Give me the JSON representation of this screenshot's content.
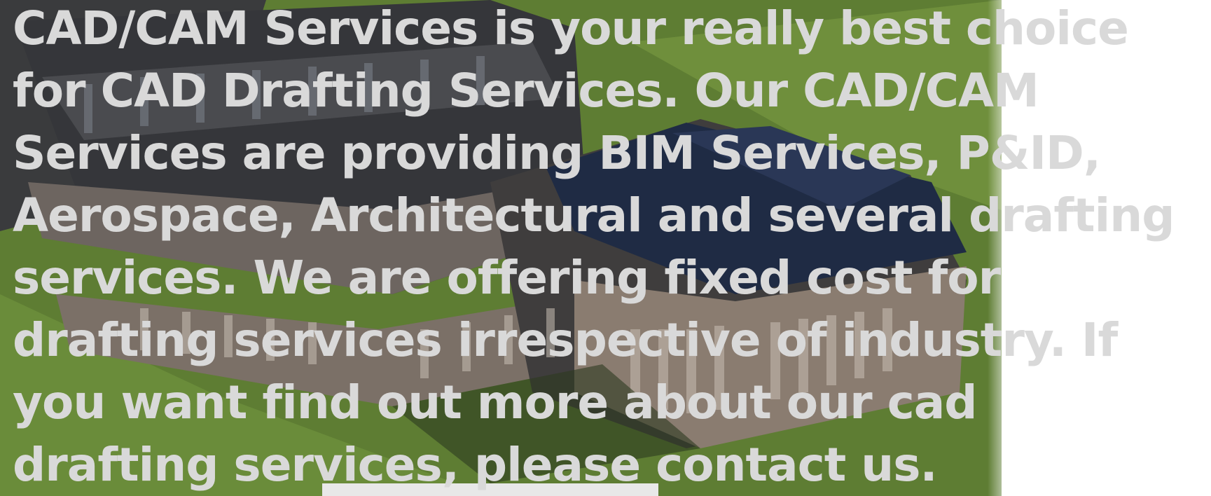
{
  "caption": {
    "lines": [
      "CAD/CAM Services is your really best choice",
      "for CAD Drafting Services. Our CAD/CAM",
      "Services are providing BIM Services, P&ID,",
      "Aerospace, Architectural and several drafting",
      "services. We are offering fixed cost for",
      "drafting services irrespective of industry. If",
      "you want find out more about our cad",
      "drafting services, please contact us."
    ]
  },
  "colors": {
    "text": "#d9d9d9",
    "grass": "#5f7f35",
    "building_dark": "#2e2f33",
    "roof": "#1e2a40",
    "background": "#ffffff"
  }
}
